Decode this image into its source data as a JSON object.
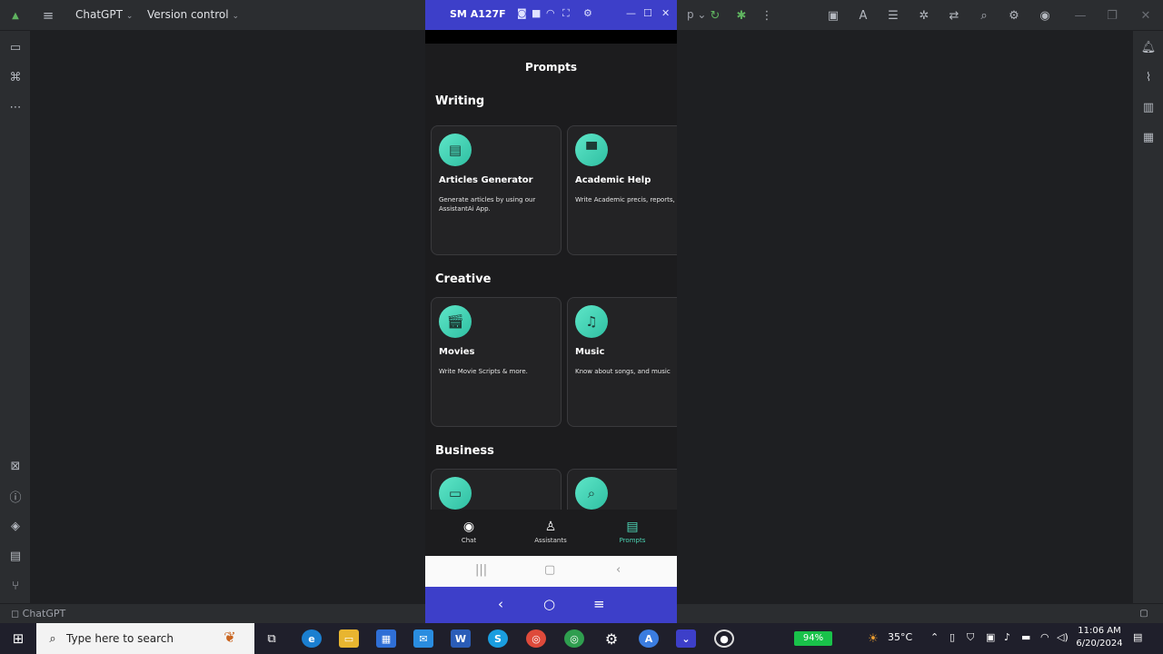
{
  "ide": {
    "project_name": "ChatGPT",
    "version_control": "Version control",
    "status_project": "ChatGPT"
  },
  "device": {
    "name": "SM A127F"
  },
  "app": {
    "header_title": "Prompts",
    "sections": [
      {
        "title": "Writing",
        "cards": [
          {
            "title": "Articles Generator",
            "desc": "Generate articles by using our AssistantAi App.",
            "icon": "document-icon"
          },
          {
            "title": "Academic Help",
            "desc": "Write Academic precis, reports, papers.",
            "icon": "graduation-cap-icon"
          }
        ]
      },
      {
        "title": "Creative",
        "cards": [
          {
            "title": "Movies",
            "desc": "Write Movie Scripts & more.",
            "icon": "clapperboard-icon"
          },
          {
            "title": "Music",
            "desc": "Know about songs, and music",
            "icon": "music-note-icon"
          }
        ]
      },
      {
        "title": "Business",
        "cards": [
          {
            "title": "",
            "desc": "",
            "icon": "presentation-icon"
          },
          {
            "title": "",
            "desc": "",
            "icon": "magnifier-icon"
          }
        ]
      }
    ],
    "bottom_nav": [
      {
        "label": "Chat",
        "icon": "chat-icon",
        "active": false
      },
      {
        "label": "Assistants",
        "icon": "person-icon",
        "active": false
      },
      {
        "label": "Prompts",
        "icon": "prompts-icon",
        "active": true
      }
    ],
    "accent": "#4dd6b5"
  },
  "taskbar": {
    "search_placeholder": "Type here to search",
    "battery": "94%",
    "temperature": "35°C",
    "time": "11:06 AM",
    "date": "6/20/2024"
  },
  "colors": {
    "emulator_blue": "#3d3fc9",
    "ide_bg": "#2b2d30",
    "taskbar_bg": "#1f1f2b"
  }
}
